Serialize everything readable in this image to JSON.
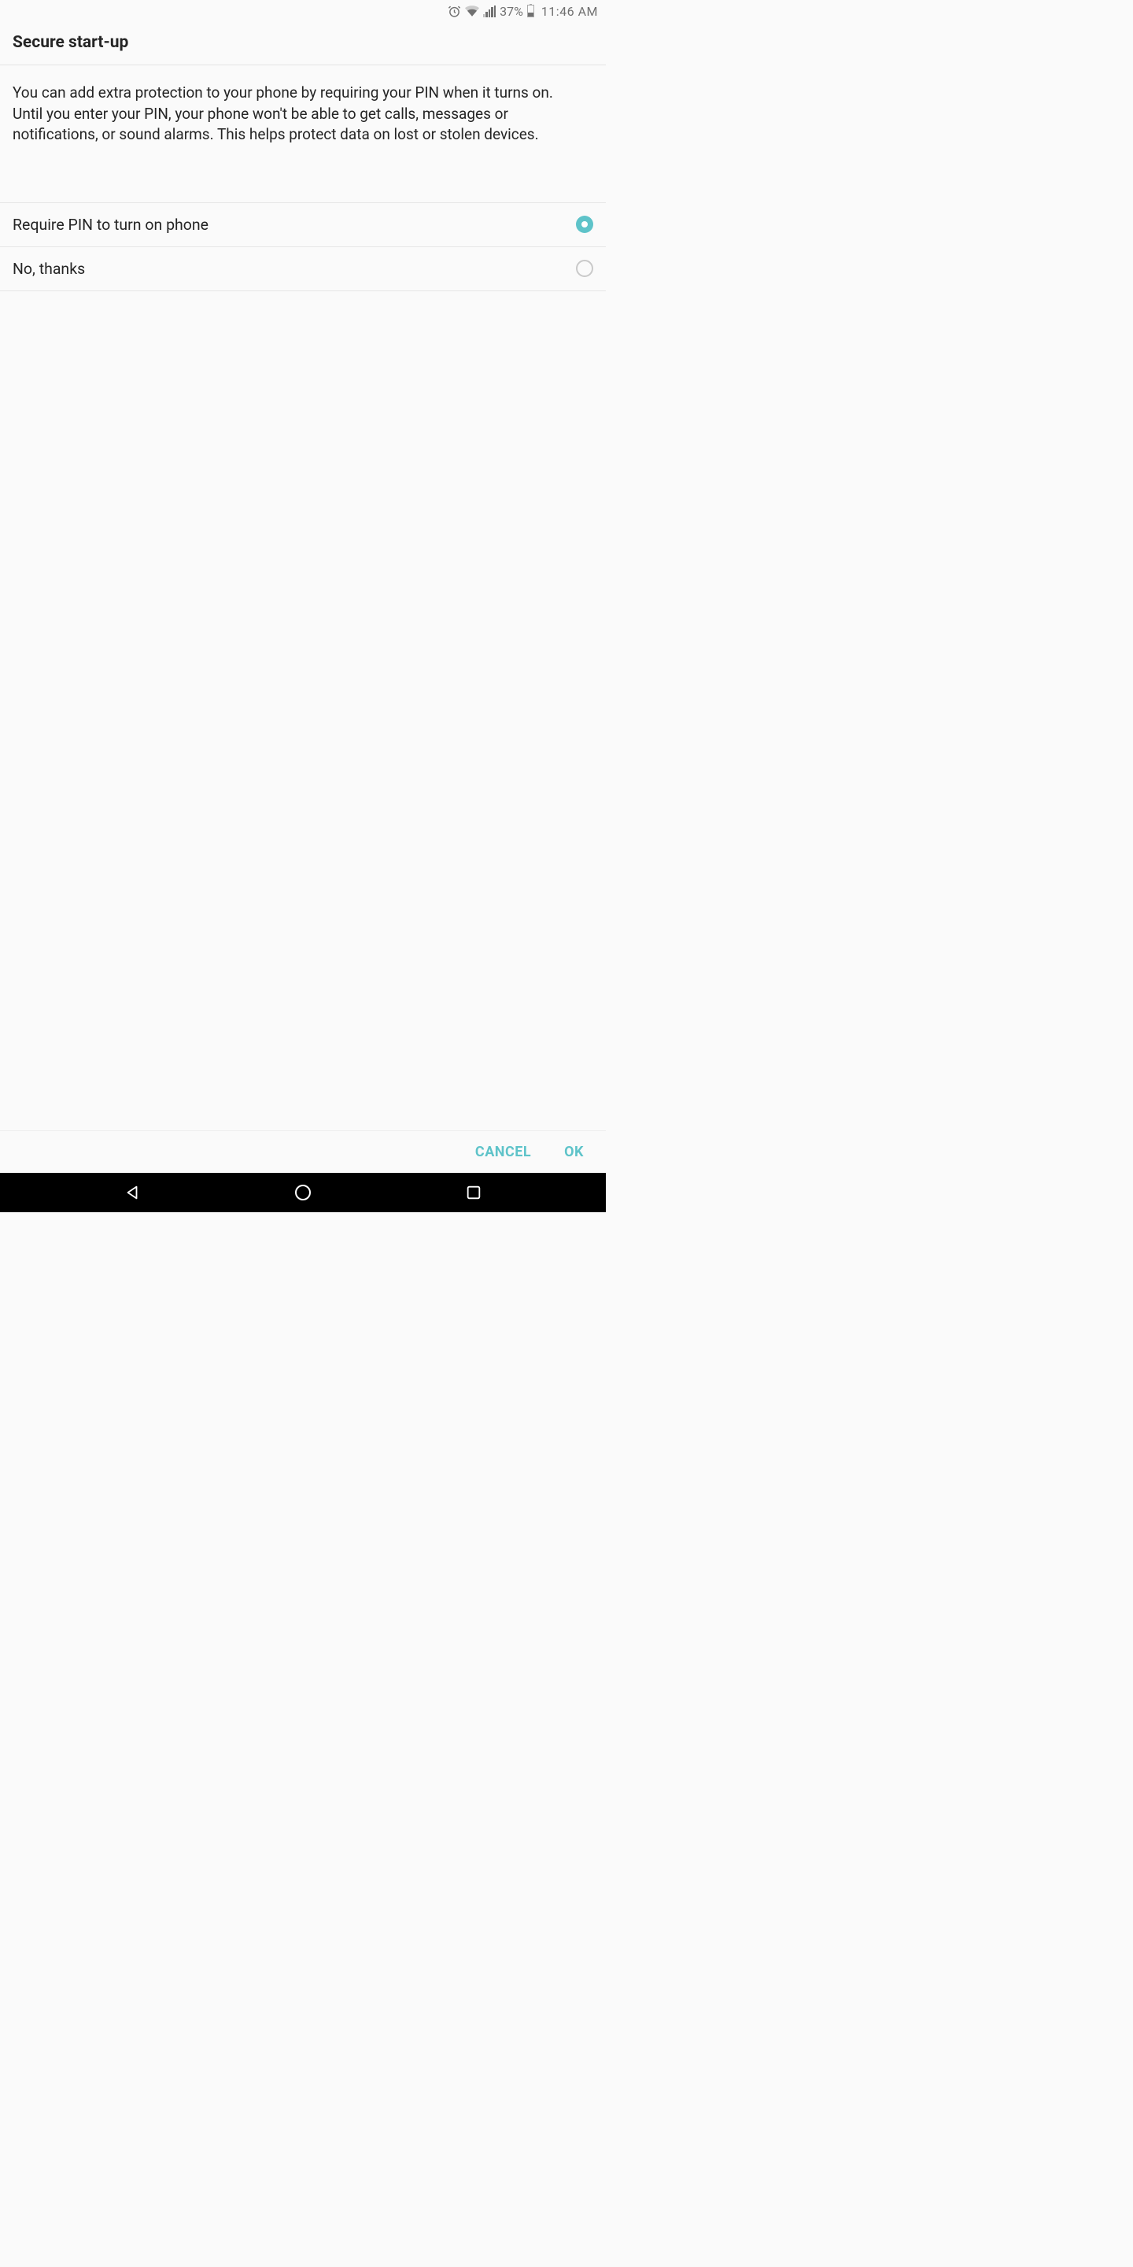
{
  "status_bar": {
    "battery_percent": "37%",
    "time": "11:46 AM"
  },
  "header": {
    "title": "Secure start-up"
  },
  "description": "You can add extra protection to your phone by requiring your PIN when it turns on.\nUntil you enter your PIN, your phone won't be able to get calls, messages or notifications, or sound alarms. This helps protect data on lost or stolen devices.",
  "options": [
    {
      "label": "Require PIN to turn on phone",
      "selected": true
    },
    {
      "label": "No, thanks",
      "selected": false
    }
  ],
  "buttons": {
    "cancel": "CANCEL",
    "ok": "OK"
  }
}
